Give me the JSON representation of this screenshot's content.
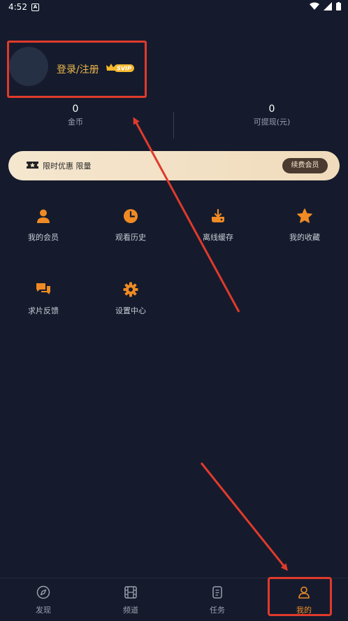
{
  "status_bar": {
    "time": "4:52",
    "notification_icon": "A"
  },
  "profile": {
    "login_label": "登录/注册",
    "badge": "SVIP"
  },
  "stats": [
    {
      "value": "0",
      "label": "金币"
    },
    {
      "value": "0",
      "label": "可提现(元)"
    }
  ],
  "vip_banner": {
    "text": "限时优惠 限量",
    "button": "续费会员"
  },
  "menu": [
    {
      "label": "我的会员",
      "icon": "person-icon"
    },
    {
      "label": "观看历史",
      "icon": "clock-icon"
    },
    {
      "label": "离线缓存",
      "icon": "download-icon"
    },
    {
      "label": "我的收藏",
      "icon": "star-icon"
    },
    {
      "label": "求片反馈",
      "icon": "chat-icon"
    },
    {
      "label": "设置中心",
      "icon": "gear-icon"
    }
  ],
  "bottom_nav": [
    {
      "label": "发现",
      "icon": "compass-icon"
    },
    {
      "label": "频道",
      "icon": "film-icon"
    },
    {
      "label": "任务",
      "icon": "task-icon"
    },
    {
      "label": "我的",
      "icon": "user-icon",
      "active": true
    }
  ],
  "colors": {
    "accent": "#f08a24",
    "background": "#151b2d",
    "annotation": "#e03a2b"
  }
}
